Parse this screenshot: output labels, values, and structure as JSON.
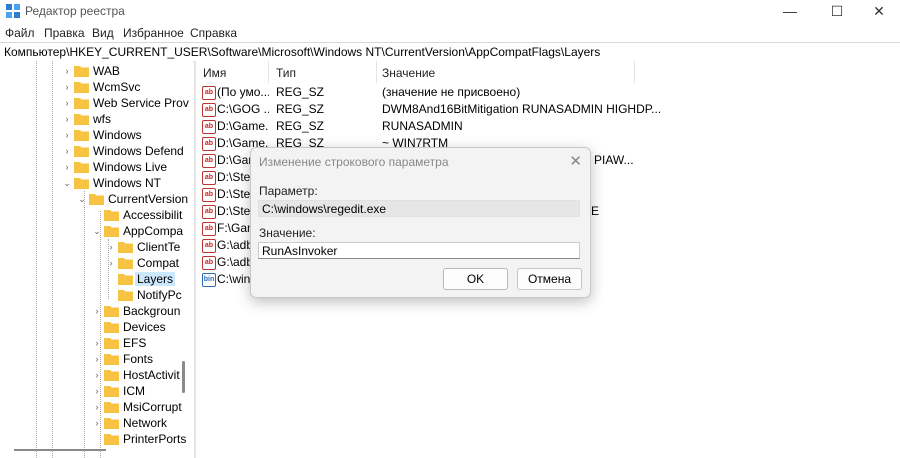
{
  "window": {
    "title": "Редактор реестра",
    "minimize": "—",
    "maximize": "☐",
    "close": "✕"
  },
  "menu": [
    "Файл",
    "Правка",
    "Вид",
    "Избранное",
    "Справка"
  ],
  "address": "Компьютер\\HKEY_CURRENT_USER\\Software\\Microsoft\\Windows NT\\CurrentVersion\\AppCompatFlags\\Layers",
  "tree": [
    {
      "label": "WAB",
      "chev": "›"
    },
    {
      "label": "WcmSvc",
      "chev": "›"
    },
    {
      "label": "Web Service Prov",
      "chev": "›"
    },
    {
      "label": "wfs",
      "chev": "›"
    },
    {
      "label": "Windows",
      "chev": "›"
    },
    {
      "label": "Windows Defend",
      "chev": "›"
    },
    {
      "label": "Windows Live",
      "chev": "›"
    },
    {
      "label": "Windows NT",
      "chev": "⌄"
    },
    {
      "label": "CurrentVersion",
      "chev": "⌄"
    },
    {
      "label": "Accessibilit",
      "chev": ""
    },
    {
      "label": "AppCompa",
      "chev": "⌄"
    },
    {
      "label": "ClientTe",
      "chev": "›"
    },
    {
      "label": "Compat",
      "chev": "›"
    },
    {
      "label": "Layers",
      "chev": ""
    },
    {
      "label": "NotifyPc",
      "chev": ""
    },
    {
      "label": "Backgroun",
      "chev": "›"
    },
    {
      "label": "Devices",
      "chev": ""
    },
    {
      "label": "EFS",
      "chev": "›"
    },
    {
      "label": "Fonts",
      "chev": "›"
    },
    {
      "label": "HostActivit",
      "chev": "›"
    },
    {
      "label": "ICM",
      "chev": "›"
    },
    {
      "label": "MsiCorrupt",
      "chev": "›"
    },
    {
      "label": "Network",
      "chev": "›"
    },
    {
      "label": "PrinterPorts",
      "chev": ""
    }
  ],
  "columns": {
    "name": "Имя",
    "type": "Тип",
    "value": "Значение"
  },
  "rows": [
    {
      "icon": "ab",
      "name": "(По умо...",
      "type": "REG_SZ",
      "value": "(значение не присвоено)"
    },
    {
      "icon": "ab",
      "name": "C:\\GOG ...",
      "type": "REG_SZ",
      "value": "DWM8And16BitMitigation RUNASADMIN HIGHDP..."
    },
    {
      "icon": "ab",
      "name": "D:\\Game...",
      "type": "REG_SZ",
      "value": "RUNASADMIN"
    },
    {
      "icon": "ab",
      "name": "D:\\Game...",
      "type": "REG_SZ",
      "value": "~ WIN7RTM"
    },
    {
      "icon": "ab",
      "name": "D:\\Gam",
      "type": "",
      "value": "PIAW..."
    },
    {
      "icon": "ab",
      "name": "D:\\Stea",
      "type": "",
      "value": ""
    },
    {
      "icon": "ab",
      "name": "D:\\Stea",
      "type": "",
      "value": ""
    },
    {
      "icon": "ab",
      "name": "D:\\Stea",
      "type": "",
      "value": "E"
    },
    {
      "icon": "ab",
      "name": "F:\\Gam",
      "type": "",
      "value": ""
    },
    {
      "icon": "ab",
      "name": "G:\\adb",
      "type": "",
      "value": ""
    },
    {
      "icon": "ab",
      "name": "G:\\adb",
      "type": "",
      "value": ""
    },
    {
      "icon": "bin",
      "name": "C:\\wind",
      "type": "",
      "value": ""
    }
  ],
  "dialog": {
    "title": "Изменение строкового параметра",
    "close": "✕",
    "param_label": "Параметр:",
    "param_value": "C:\\windows\\regedit.exe",
    "value_label": "Значение:",
    "value_value": "RunAsInvoker",
    "ok": "OK",
    "cancel": "Отмена"
  }
}
